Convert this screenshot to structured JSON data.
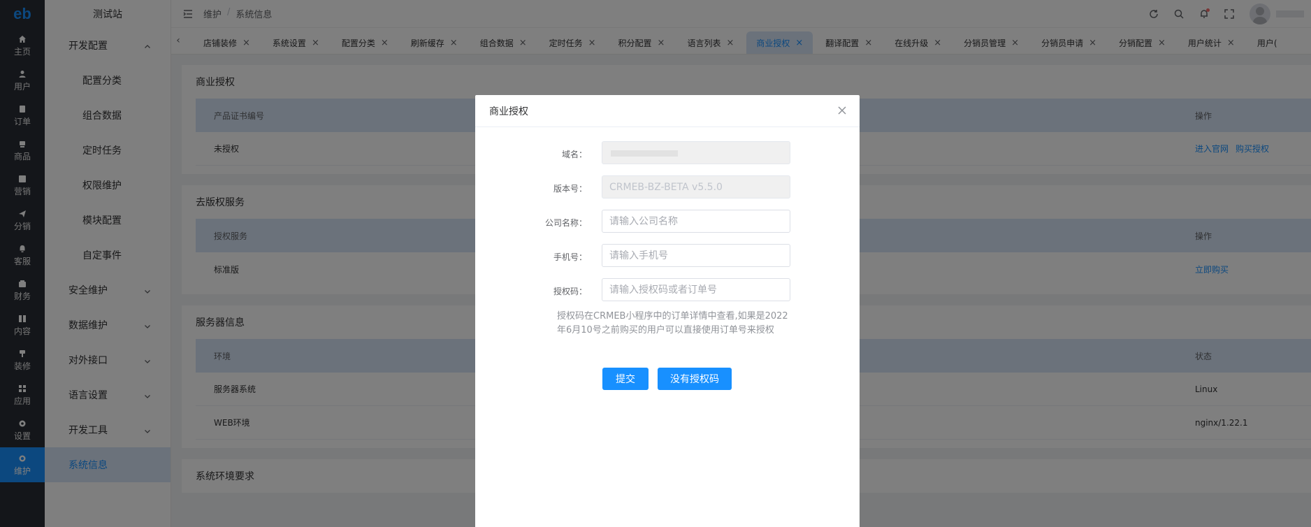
{
  "rail": {
    "logo": "eb",
    "items": [
      {
        "label": "主页",
        "icon": "home-icon"
      },
      {
        "label": "用户",
        "icon": "user-icon"
      },
      {
        "label": "订单",
        "icon": "order-icon"
      },
      {
        "label": "商品",
        "icon": "product-icon"
      },
      {
        "label": "营销",
        "icon": "marketing-icon"
      },
      {
        "label": "分销",
        "icon": "distribution-icon"
      },
      {
        "label": "客服",
        "icon": "service-icon"
      },
      {
        "label": "财务",
        "icon": "finance-icon"
      },
      {
        "label": "内容",
        "icon": "content-icon"
      },
      {
        "label": "装修",
        "icon": "decorate-icon"
      },
      {
        "label": "应用",
        "icon": "apps-icon"
      },
      {
        "label": "设置",
        "icon": "settings-icon"
      },
      {
        "label": "维护",
        "icon": "maintain-icon"
      }
    ]
  },
  "submenu": {
    "site_name": "测试站",
    "group_open": "开发配置",
    "children": [
      "配置分类",
      "组合数据",
      "定时任务",
      "权限维护",
      "模块配置",
      "自定事件"
    ],
    "groups": [
      "安全维护",
      "数据维护",
      "对外接口",
      "语言设置",
      "开发工具"
    ],
    "active": "系统信息"
  },
  "header": {
    "breadcrumb": [
      "维护",
      "系统信息"
    ]
  },
  "tabs": [
    "店铺装修",
    "系统设置",
    "配置分类",
    "刷新缓存",
    "组合数据",
    "定时任务",
    "积分配置",
    "语言列表",
    "商业授权",
    "翻译配置",
    "在线升级",
    "分销员管理",
    "分销员申请",
    "分销配置",
    "用户统计",
    "用户("
  ],
  "cards": {
    "license": {
      "title": "商业授权",
      "head": [
        "产品证书编号",
        "操作"
      ],
      "row": [
        "未授权"
      ],
      "links": [
        "进入官网",
        "购买授权"
      ]
    },
    "copyright": {
      "title": "去版权服务",
      "head": [
        "授权服务",
        "操作"
      ],
      "row": [
        "标准版"
      ],
      "links": [
        "立即购买"
      ]
    },
    "server": {
      "title": "服务器信息",
      "head": [
        "环境",
        "状态"
      ],
      "rows": [
        [
          "服务器系统",
          "Linux"
        ],
        [
          "WEB环境",
          "nginx/1.22.1"
        ]
      ]
    },
    "env": {
      "title": "系统环境要求"
    }
  },
  "modal": {
    "title": "商业授权",
    "fields": {
      "domain_label": "域名：",
      "version_label": "版本号：",
      "version_value": "CRMEB-BZ-BETA v5.5.0",
      "company_label": "公司名称：",
      "company_placeholder": "请输入公司名称",
      "phone_label": "手机号：",
      "phone_placeholder": "请输入手机号",
      "code_label": "授权码：",
      "code_placeholder": "请输入授权码或者订单号"
    },
    "hint": "授权码在CRMEB小程序中的订单详情中查看,如果是2022年6月10号之前购买的用户可以直接使用订单号来授权",
    "submit": "提交",
    "no_code": "没有授权码"
  },
  "colors": {
    "primary": "#1890ff",
    "rail_bg": "#282c34",
    "active_bg": "#d6e4f6"
  }
}
